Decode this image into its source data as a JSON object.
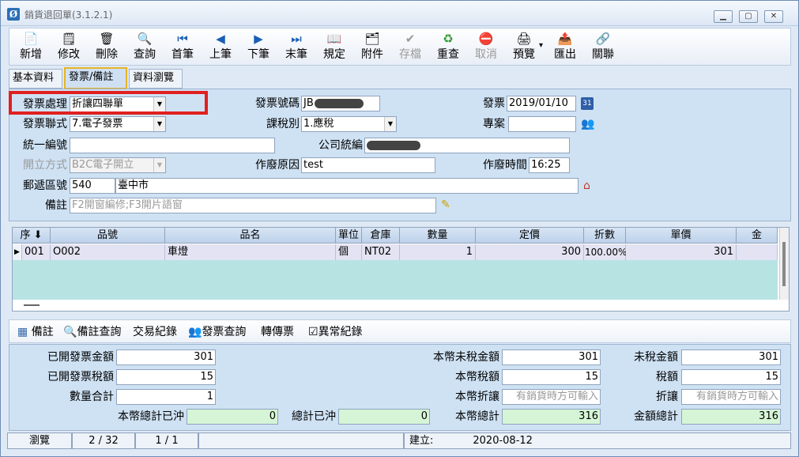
{
  "window": {
    "title": "銷貨退回單(3.1.2.1)",
    "app_icon": "Ø",
    "min": "▁",
    "max": "▢",
    "close": "✕"
  },
  "toolbar": {
    "buttons": [
      {
        "label": "新增",
        "icon": "📄",
        "enabled": true
      },
      {
        "label": "修改",
        "icon": "🗒",
        "enabled": true
      },
      {
        "label": "刪除",
        "icon": "🗑",
        "enabled": true
      },
      {
        "label": "查詢",
        "icon": "🔍",
        "enabled": true
      },
      {
        "label": "首筆",
        "icon": "⏮",
        "enabled": true
      },
      {
        "label": "上筆",
        "icon": "◀",
        "enabled": true
      },
      {
        "label": "下筆",
        "icon": "▶",
        "enabled": true
      },
      {
        "label": "末筆",
        "icon": "⏭",
        "enabled": true
      },
      {
        "label": "規定",
        "icon": "📖",
        "enabled": true
      },
      {
        "label": "附件",
        "icon": "🗂",
        "enabled": true
      },
      {
        "label": "存檔",
        "icon": "✔",
        "enabled": false
      },
      {
        "label": "重查",
        "icon": "♻",
        "enabled": true
      },
      {
        "label": "取消",
        "icon": "⛔",
        "enabled": false
      },
      {
        "label": "預覽",
        "icon": "🖨",
        "enabled": true
      },
      {
        "label": "匯出",
        "icon": "📤",
        "enabled": true
      },
      {
        "label": "關聯",
        "icon": "🔗",
        "enabled": true
      }
    ],
    "preview_arrow": "▾"
  },
  "tabs": [
    {
      "label": "基本資料",
      "active": false
    },
    {
      "label": "發票/備註",
      "active": true
    },
    {
      "label": "資料瀏覽",
      "active": false
    }
  ],
  "form": {
    "invoice_process_label": "發票處理",
    "invoice_process_value": "折讓四聯單",
    "invoice_no_label": "發票號碼",
    "invoice_no_value": "JB",
    "invoice_date_label": "發票日期",
    "invoice_date_value": "2019/01/10",
    "calendar_icon": "31",
    "invoice_copy_label": "發票聯式",
    "invoice_copy_value": "7.電子發票",
    "tax_type_label": "課稅別",
    "tax_type_value": "1.應稅",
    "project_label": "專案",
    "project_value": "",
    "unified_no_label": "統一編號",
    "unified_no_value": "",
    "company_no_label": "公司統編",
    "company_no_value": "",
    "issue_method_label": "開立方式",
    "issue_method_value": "B2C電子開立",
    "void_reason_label": "作廢原因",
    "void_reason_value": "test",
    "void_time_label": "作廢時間",
    "void_time_value": "16:25",
    "zip_label": "郵遞區號",
    "zip_value": "540",
    "address_value": "臺中市",
    "remark_label": "備註",
    "remark_placeholder": "F2開窗編修;F3開片語窗",
    "dropdown_arrow": "▼"
  },
  "grid": {
    "headers": [
      "序",
      "品號",
      "品名",
      "單位",
      "倉庫",
      "數量",
      "定價",
      "折數",
      "單價",
      "金"
    ],
    "rows": [
      {
        "marker": "▶",
        "seq": "001",
        "item_no": "O002",
        "item_name": "車燈",
        "unit": "個",
        "warehouse": "NT02",
        "qty": "1",
        "list_price": "300",
        "discount": "100.00%",
        "unit_price": "301"
      }
    ]
  },
  "actions": [
    {
      "label": "備註",
      "icon": "▦"
    },
    {
      "label": "備註查詢",
      "icon": "🔍"
    },
    {
      "label": "交易紀錄",
      "icon": ""
    },
    {
      "label": "發票查詢",
      "icon": "👥"
    },
    {
      "label": "轉傳票",
      "icon": ""
    },
    {
      "label": "異常紀錄",
      "icon": "☑"
    }
  ],
  "summary": {
    "issued_amount_label": "已開發票金額",
    "issued_amount": "301",
    "issued_tax_label": "已開發票稅額",
    "issued_tax": "15",
    "qty_total_label": "數量合計",
    "qty_total": "1",
    "local_total_offset_label": "本幣總計已沖",
    "local_total_offset": "0",
    "total_offset_label": "總計已沖",
    "total_offset": "0",
    "local_pretax_label": "本幣未稅金額",
    "local_pretax": "301",
    "local_tax_label": "本幣稅額",
    "local_tax": "15",
    "local_discount_label": "本幣折讓",
    "local_discount_ph": "有銷貨時方可輸入",
    "local_total_label": "本幣總計",
    "local_total": "316",
    "pretax_label": "未稅金額",
    "pretax": "301",
    "tax_label": "稅額",
    "tax": "15",
    "discount_label": "折讓",
    "discount_ph": "有銷貨時方可輸入",
    "amount_total_label": "金額總計",
    "amount_total": "316"
  },
  "status": {
    "mode": "瀏覽",
    "record": "2 / 32",
    "page": "1 / 1",
    "created": "建立:",
    "created_date": "2020-08-12"
  }
}
